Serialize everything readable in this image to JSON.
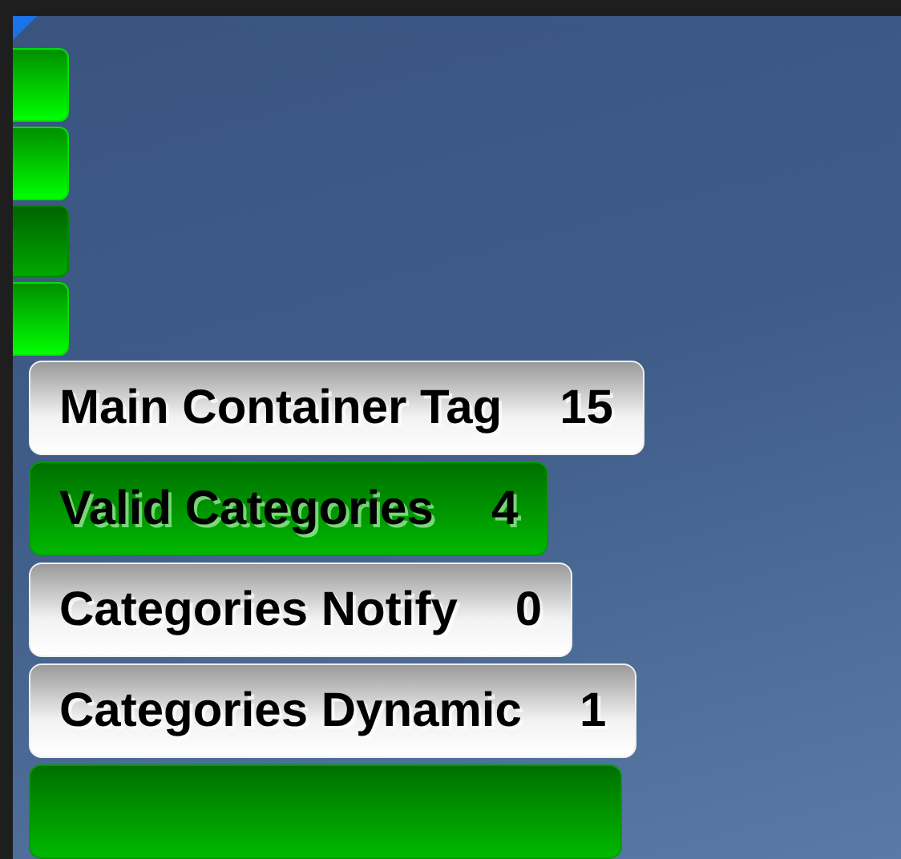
{
  "side_tabs": [
    {
      "selected": false
    },
    {
      "selected": false
    },
    {
      "selected": true
    },
    {
      "selected": false
    }
  ],
  "rows": [
    {
      "label": "Main Container Tag",
      "count": "15",
      "selected": false
    },
    {
      "label": "Valid Categories",
      "count": "4",
      "selected": true
    },
    {
      "label": "Categories Notify",
      "count": "0",
      "selected": false
    },
    {
      "label": "Categories Dynamic",
      "count": "1",
      "selected": false
    },
    {
      "selected": true
    }
  ]
}
